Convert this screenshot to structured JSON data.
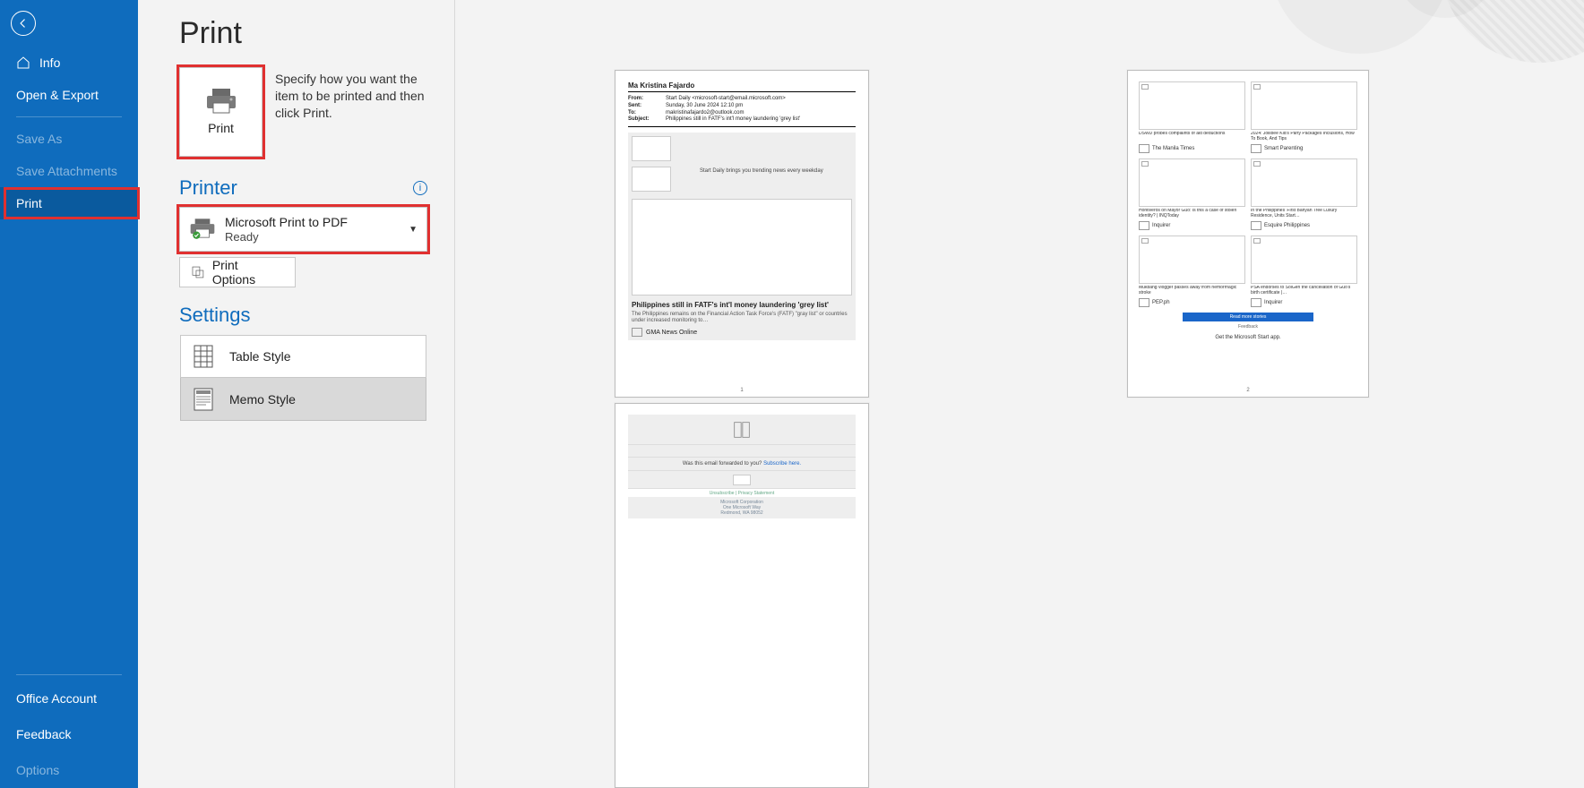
{
  "sidebar": {
    "items": [
      {
        "label": "Info"
      },
      {
        "label": "Open & Export"
      },
      {
        "label": "Save As"
      },
      {
        "label": "Save Attachments"
      },
      {
        "label": "Print"
      }
    ],
    "bottom": [
      {
        "label": "Office Account"
      },
      {
        "label": "Feedback"
      },
      {
        "label": "Options"
      }
    ]
  },
  "header": {
    "title": "Print"
  },
  "print_button": {
    "label": "Print"
  },
  "print_desc": "Specify how you want the item to be printed and then click Print.",
  "printer": {
    "section": "Printer",
    "name": "Microsoft Print to PDF",
    "status": "Ready",
    "options_label": "Print Options"
  },
  "settings": {
    "section": "Settings",
    "styles": [
      {
        "label": "Table Style"
      },
      {
        "label": "Memo Style"
      }
    ]
  },
  "preview": {
    "page1": {
      "name": "Ma Kristina Fajardo",
      "from_label": "From:",
      "from": "Start Daily <microsoft-start@email.microsoft.com>",
      "sent_label": "Sent:",
      "sent": "Sunday, 30 June 2024 12:10 pm",
      "to_label": "To:",
      "to": "makristinafajardo2@outlook.com",
      "subject_label": "Subject:",
      "subject": "Philippines still in FATF's int'l money laundering 'grey list'",
      "tagline": "Start Daily brings you trending news every weekday",
      "headline": "Philippines still in FATF's int'l money laundering 'grey list'",
      "subhead": "The Philippines remains on the Financial Action Task Force's (FATF) \"gray list\" or countries under increased monitoring to…",
      "source": "GMA News Online",
      "page_no": "1"
    },
    "page2": {
      "forward_text": "Was this email forwarded to you? ",
      "subscribe": "Subscribe here.",
      "unsubscribe": "Unsubscribe | Privacy Statement",
      "corp1": "Microsoft Corporation",
      "corp2": "One Microsoft Way",
      "corp3": "Redmond, WA 98052"
    },
    "page3": {
      "cards": [
        {
          "caption": "DSWD probes complaints of aid deductions",
          "source": "The Manila Times"
        },
        {
          "caption": "2024: Jollibee Kid's Party Packages Inclusions, How To Book, And Tips",
          "source": "Smart Parenting"
        },
        {
          "caption": "Hontiveros on Mayor Guo: Is this a case of stolen identity? | INQToday",
          "source": "Inquirer"
        },
        {
          "caption": "In the Philippines' First Banyan Tree Luxury Residence, Units Start…",
          "source": "Esquire Philippines"
        },
        {
          "caption": "Mukbang vlogger passes away from hemorrhagic stroke",
          "source": "PEP.ph"
        },
        {
          "caption": "PSA endorses to SolGen the cancellation of Guo's birth certificate |…",
          "source": "Inquirer"
        }
      ],
      "more": "Read more stories",
      "feedback": "Feedback",
      "get_app": "Get the Microsoft Start app.",
      "page_no": "2"
    }
  }
}
